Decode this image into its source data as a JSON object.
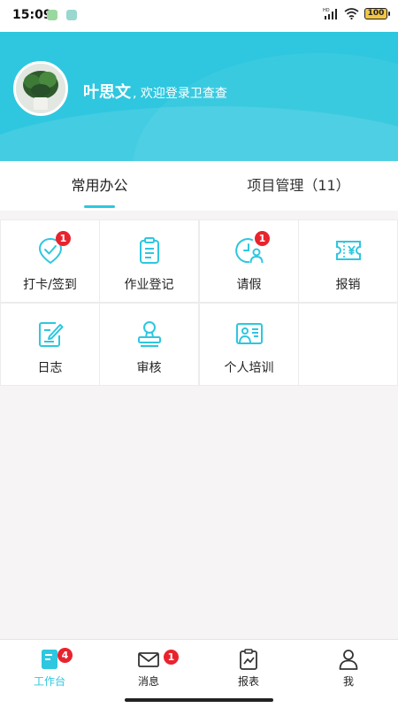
{
  "status_bar": {
    "time": "15:09",
    "battery": "100"
  },
  "header": {
    "user_name": "叶思文",
    "welcome_text": ", 欢迎登录卫查查"
  },
  "tabs": [
    {
      "label": "常用办公",
      "active": true
    },
    {
      "label": "项目管理（11）",
      "active": false
    }
  ],
  "grid_items": [
    {
      "label": "打卡/签到",
      "icon": "checkin-icon",
      "badge": "1"
    },
    {
      "label": "作业登记",
      "icon": "clipboard-icon",
      "badge": ""
    },
    {
      "label": "请假",
      "icon": "leave-clock-person-icon",
      "badge": "1"
    },
    {
      "label": "报销",
      "icon": "reimburse-ticket-icon",
      "badge": ""
    },
    {
      "label": "日志",
      "icon": "log-edit-icon",
      "badge": ""
    },
    {
      "label": "审核",
      "icon": "stamp-icon",
      "badge": ""
    },
    {
      "label": "个人培训",
      "icon": "training-board-icon",
      "badge": ""
    }
  ],
  "bottom_nav": [
    {
      "label": "工作台",
      "icon": "workbench-icon",
      "badge": "4",
      "active": true
    },
    {
      "label": "消息",
      "icon": "mail-icon",
      "badge": "1",
      "active": false
    },
    {
      "label": "报表",
      "icon": "report-icon",
      "badge": "",
      "active": false
    },
    {
      "label": "我",
      "icon": "profile-icon",
      "badge": "",
      "active": false
    }
  ],
  "colors": {
    "accent": "#2ec7df",
    "badge": "#e8232d"
  }
}
